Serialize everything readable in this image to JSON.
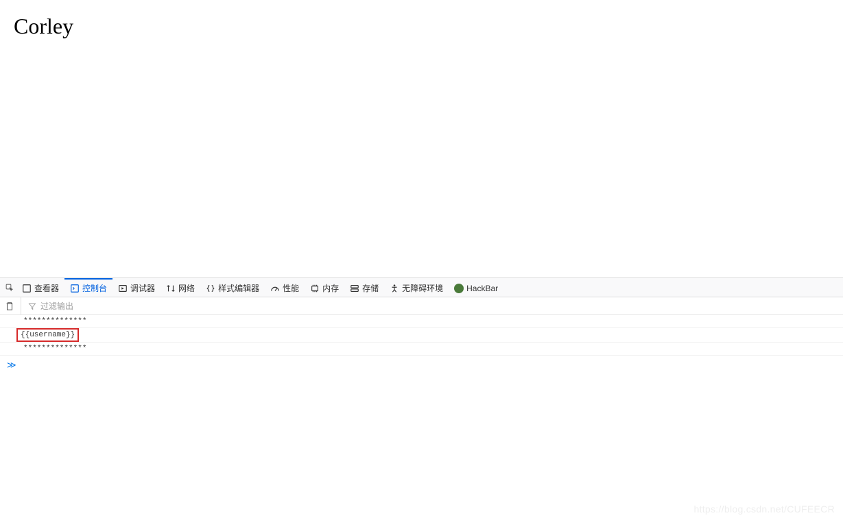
{
  "page": {
    "heading": "Corley"
  },
  "devtools": {
    "tabs": {
      "inspector": "查看器",
      "console": "控制台",
      "debugger": "调试器",
      "network": "网络",
      "styleeditor": "样式编辑器",
      "performance": "性能",
      "memory": "内存",
      "storage": "存储",
      "accessibility": "无障碍环境",
      "hackbar": "HackBar"
    }
  },
  "console": {
    "filter_placeholder": "过滤输出",
    "logs": {
      "line1": "**************",
      "line2": "{{username}}",
      "line3": "**************"
    },
    "prompt": "≫"
  },
  "watermark": "https://blog.csdn.net/CUFEECR"
}
